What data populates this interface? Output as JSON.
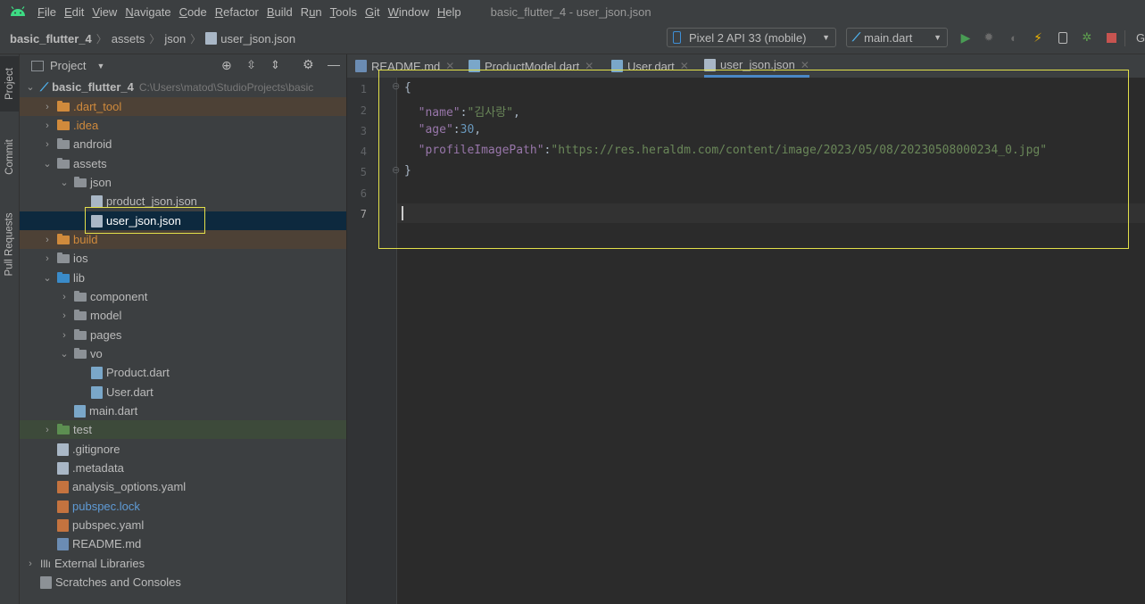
{
  "menubar": {
    "items": [
      "File",
      "Edit",
      "View",
      "Navigate",
      "Code",
      "Refactor",
      "Build",
      "Run",
      "Tools",
      "Git",
      "Window",
      "Help"
    ],
    "mnemonics": [
      "F",
      "E",
      "V",
      "N",
      "C",
      "R",
      "B",
      "u",
      "T",
      "G",
      "W",
      "H"
    ],
    "window_title": "basic_flutter_4 - user_json.json"
  },
  "navbar": {
    "breadcrumbs": [
      "basic_flutter_4",
      "assets",
      "json",
      "user_json.json"
    ],
    "device": "Pixel 2 API 33 (mobile)",
    "run_config": "main.dart",
    "overflow_label": "G"
  },
  "stripe": {
    "project": "Project",
    "commit": "Commit",
    "pull_requests": "Pull Requests"
  },
  "project_panel": {
    "title": "Project",
    "tree": [
      {
        "label": "basic_flutter_4",
        "path": "C:\\Users\\matod\\StudioProjects\\basic",
        "depth": 0,
        "chev": "open",
        "icon": "flutter",
        "bold": true
      },
      {
        "label": ".dart_tool",
        "depth": 1,
        "chev": "closed",
        "icon": "folder-orange",
        "color": "#d08a3c",
        "bg": "#4d4136"
      },
      {
        "label": ".idea",
        "depth": 1,
        "chev": "closed",
        "icon": "folder-gear",
        "color": "#d08a3c",
        "bg": "#3c3f41"
      },
      {
        "label": "android",
        "depth": 1,
        "chev": "closed",
        "icon": "folder-gray"
      },
      {
        "label": "assets",
        "depth": 1,
        "chev": "open",
        "icon": "folder-gray"
      },
      {
        "label": "json",
        "depth": 2,
        "chev": "open",
        "icon": "folder-gray"
      },
      {
        "label": "product_json.json",
        "depth": 3,
        "chev": "none",
        "icon": "json-file"
      },
      {
        "label": "user_json.json",
        "depth": 3,
        "chev": "none",
        "icon": "json-file",
        "selected": true
      },
      {
        "label": "build",
        "depth": 1,
        "chev": "closed",
        "icon": "folder-orange",
        "color": "#d08a3c",
        "bg": "#4d4136"
      },
      {
        "label": "ios",
        "depth": 1,
        "chev": "closed",
        "icon": "folder-gray"
      },
      {
        "label": "lib",
        "depth": 1,
        "chev": "open",
        "icon": "folder-blue"
      },
      {
        "label": "component",
        "depth": 2,
        "chev": "closed",
        "icon": "folder-gray"
      },
      {
        "label": "model",
        "depth": 2,
        "chev": "closed",
        "icon": "folder-gray"
      },
      {
        "label": "pages",
        "depth": 2,
        "chev": "closed",
        "icon": "folder-gray"
      },
      {
        "label": "vo",
        "depth": 2,
        "chev": "open",
        "icon": "folder-gray"
      },
      {
        "label": "Product.dart",
        "depth": 3,
        "chev": "none",
        "icon": "dart-file"
      },
      {
        "label": "User.dart",
        "depth": 3,
        "chev": "none",
        "icon": "dart-file"
      },
      {
        "label": "main.dart",
        "depth": 2,
        "chev": "none",
        "icon": "dart-file"
      },
      {
        "label": "test",
        "depth": 1,
        "chev": "closed",
        "icon": "folder-green",
        "bg": "#3d4a3a"
      },
      {
        "label": ".gitignore",
        "depth": 1,
        "chev": "none",
        "icon": "text-file"
      },
      {
        "label": ".metadata",
        "depth": 1,
        "chev": "none",
        "icon": "text-file"
      },
      {
        "label": "analysis_options.yaml",
        "depth": 1,
        "chev": "none",
        "icon": "yaml-file"
      },
      {
        "label": "pubspec.lock",
        "depth": 1,
        "chev": "none",
        "icon": "yaml-file",
        "color": "#5f9bd6"
      },
      {
        "label": "pubspec.yaml",
        "depth": 1,
        "chev": "none",
        "icon": "yaml-file"
      },
      {
        "label": "README.md",
        "depth": 1,
        "chev": "none",
        "icon": "md-file"
      },
      {
        "label": "External Libraries",
        "depth": 0,
        "chev": "closed",
        "icon": "library"
      },
      {
        "label": "Scratches and Consoles",
        "depth": 0,
        "chev": "none",
        "icon": "scratch"
      }
    ]
  },
  "editor": {
    "tabs": [
      {
        "label": "README.md",
        "icon": "md-file"
      },
      {
        "label": "ProductModel.dart",
        "icon": "dart-file"
      },
      {
        "label": "User.dart",
        "icon": "dart-file"
      },
      {
        "label": "user_json.json",
        "icon": "json-file",
        "active": true
      }
    ],
    "line_numbers": [
      "1",
      "2",
      "3",
      "4",
      "5",
      "6",
      "7"
    ],
    "code": {
      "l1": "{",
      "k_name": "\"name\"",
      "v_name": "\"김사랑\"",
      "k_age": "\"age\"",
      "v_age": "30",
      "k_path": "\"profileImagePath\"",
      "v_path": "\"https://res.heraldm.com/content/image/2023/05/08/20230508000234_0.jpg\"",
      "l5": "}"
    }
  },
  "colors": {
    "highlight": "#e3e04a",
    "accent": "#4a88c7",
    "json_key": "#9876aa",
    "json_string": "#6a8759",
    "json_number": "#6897bb"
  }
}
